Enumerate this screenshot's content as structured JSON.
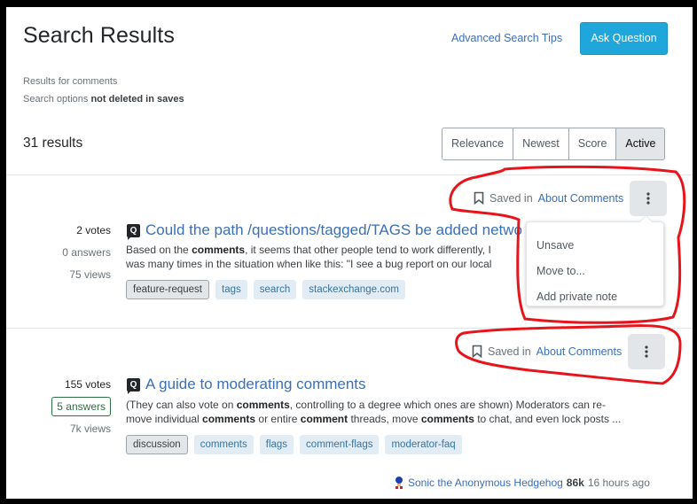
{
  "header": {
    "title": "Search Results",
    "advanced_link": "Advanced Search Tips",
    "ask_button": "Ask Question"
  },
  "subtitle": {
    "results_for_prefix": "Results for ",
    "results_for_term": "comments",
    "options_prefix": "Search options ",
    "options_value": "not deleted in saves"
  },
  "results_count": "31 results",
  "sort": {
    "options": [
      "Relevance",
      "Newest",
      "Score",
      "Active"
    ],
    "selected": "Active"
  },
  "results": [
    {
      "saved_prefix": "Saved in",
      "saved_list": "About Comments",
      "votes": "2 votes",
      "answers": "0 answers",
      "views": "75 views",
      "type_icon": "Q",
      "title": "Could the path /questions/tagged/TAGS be added netwo",
      "excerpt_line1": [
        "Based on the ",
        "comments",
        ", it seems that other people tend to work differently, I"
      ],
      "excerpt_line2": "was many times in the situation when like this: \"I see a bug report on our local",
      "tags": [
        "feature-request",
        "tags",
        "search",
        "stackexchange.com"
      ],
      "menu_open": true,
      "menu": [
        "Unsave",
        "Move to...",
        "Add private note"
      ]
    },
    {
      "saved_prefix": "Saved in",
      "saved_list": "About Comments",
      "votes": "155 votes",
      "answers": "5 answers",
      "views": "7k views",
      "type_icon": "Q",
      "title": "A guide to moderating comments",
      "excerpt_line1": [
        "(They can also vote on ",
        "comments",
        ", controlling to a degree which ones are shown) Moderators can re-"
      ],
      "excerpt_line2_parts": [
        "move individual ",
        "comments",
        " or entire ",
        "comment",
        " threads, move ",
        "comments",
        " to chat, and even lock posts ..."
      ],
      "tags": [
        "discussion",
        "comments",
        "flags",
        "comment-flags",
        "moderator-faq"
      ],
      "author": "Sonic the Anonymous Hedgehog",
      "reputation": "86k",
      "time": "16 hours ago"
    }
  ],
  "colors": {
    "accent": "#1fa7dc",
    "link": "#3b6fb6",
    "annotation": "#e8141c",
    "answered_border": "#2f6f44"
  }
}
